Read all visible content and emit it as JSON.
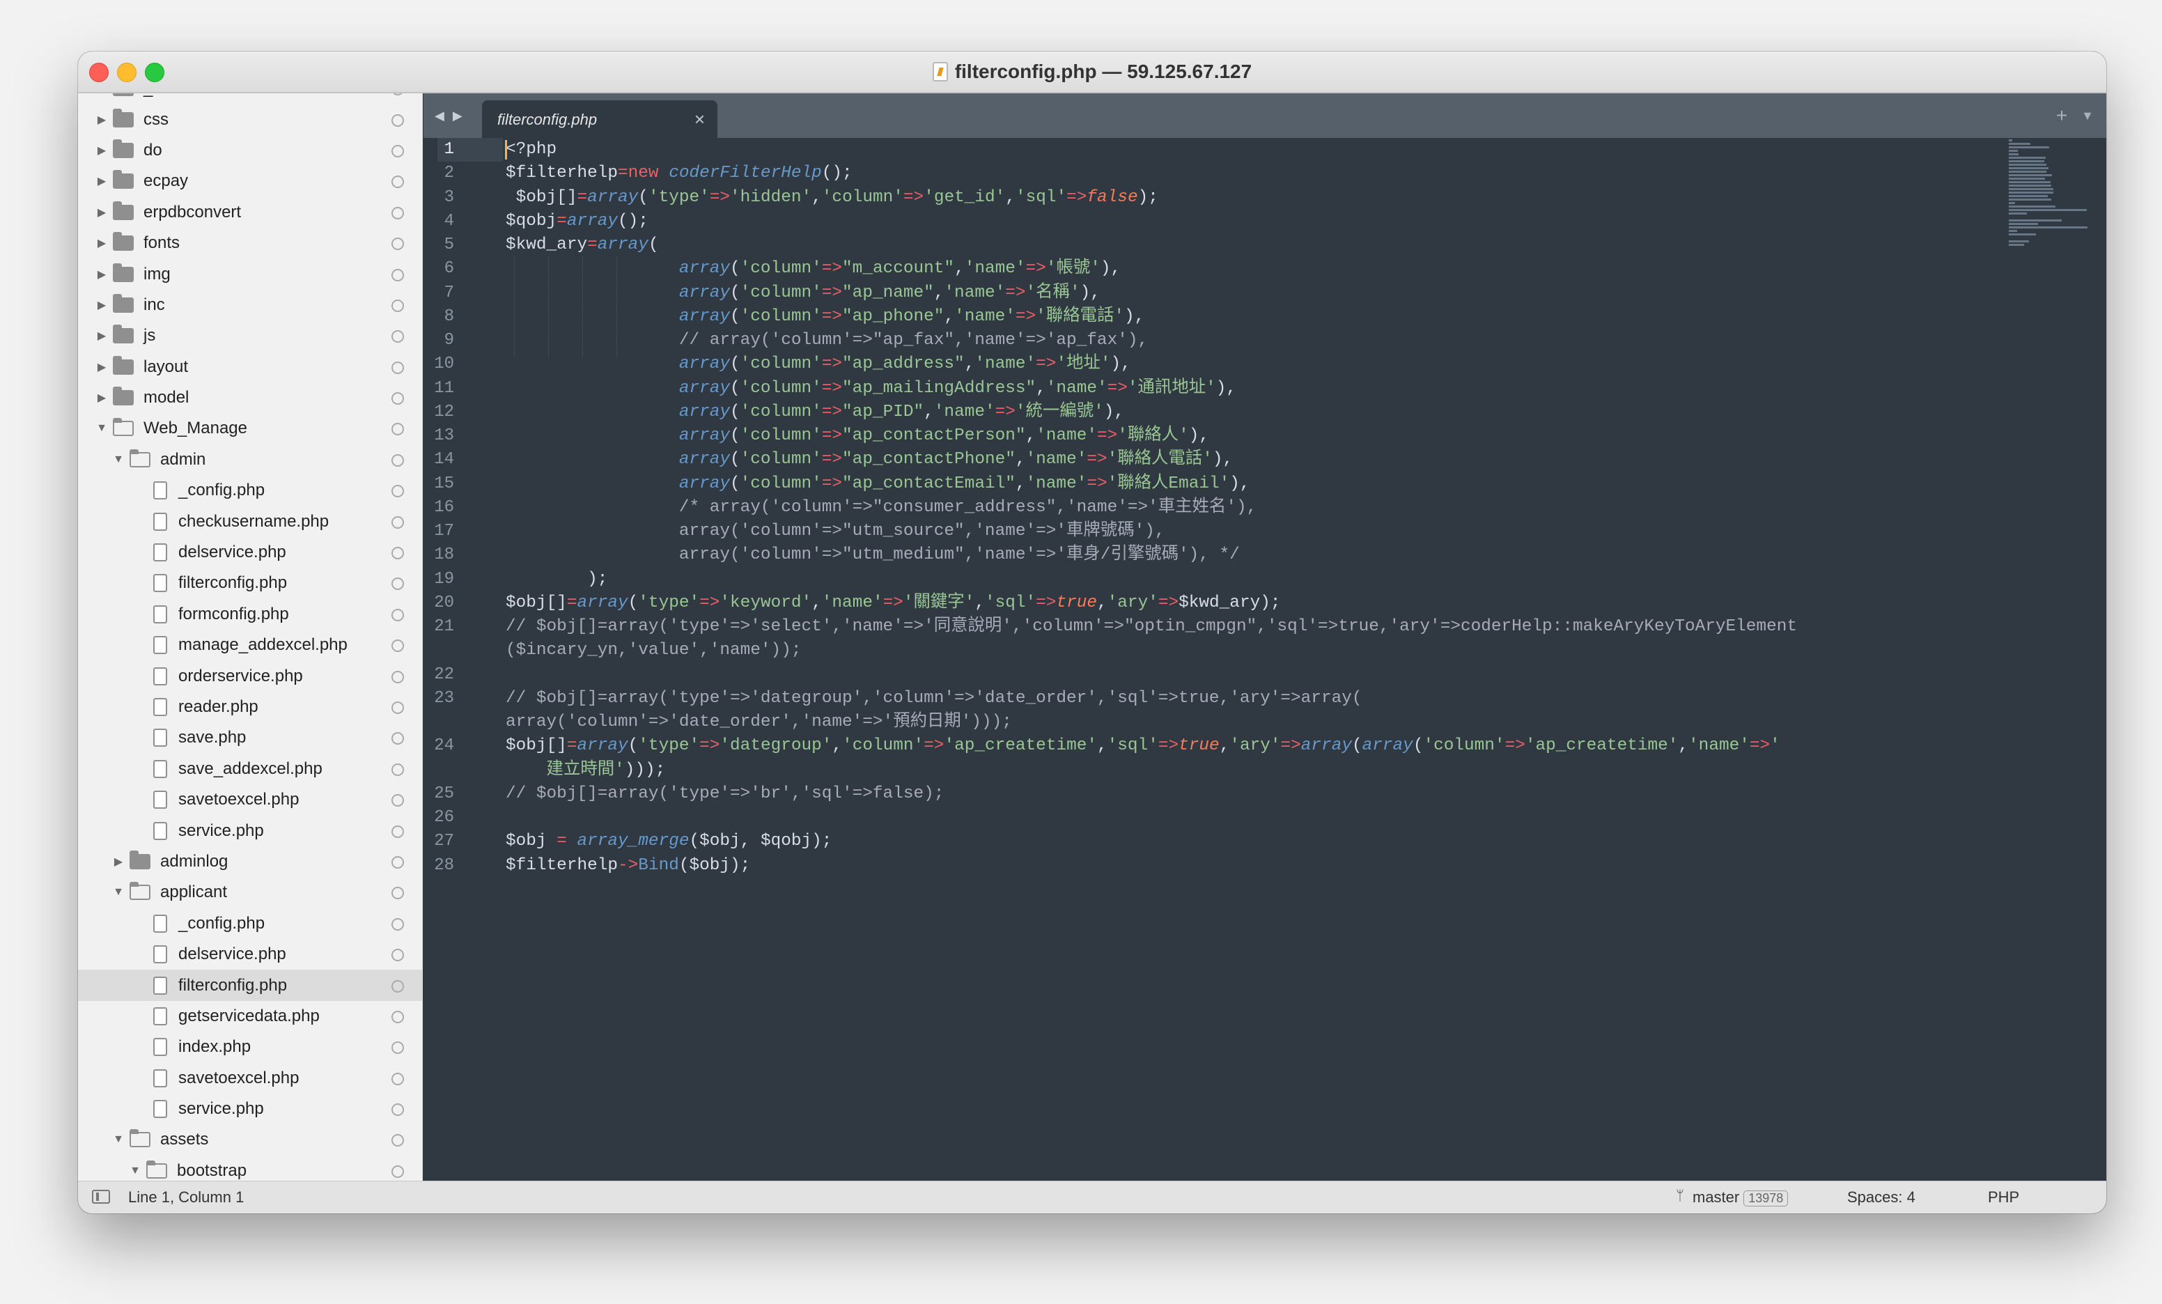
{
  "window": {
    "title": "filterconfig.php — 59.125.67.127"
  },
  "sidebar": {
    "rows": [
      {
        "depth": 0,
        "kind": "folder",
        "open": false,
        "label": "_sass"
      },
      {
        "depth": 0,
        "kind": "folder",
        "open": false,
        "label": "css"
      },
      {
        "depth": 0,
        "kind": "folder",
        "open": false,
        "label": "do"
      },
      {
        "depth": 0,
        "kind": "folder",
        "open": false,
        "label": "ecpay"
      },
      {
        "depth": 0,
        "kind": "folder",
        "open": false,
        "label": "erpdbconvert"
      },
      {
        "depth": 0,
        "kind": "folder",
        "open": false,
        "label": "fonts"
      },
      {
        "depth": 0,
        "kind": "folder",
        "open": false,
        "label": "img"
      },
      {
        "depth": 0,
        "kind": "folder",
        "open": false,
        "label": "inc"
      },
      {
        "depth": 0,
        "kind": "folder",
        "open": false,
        "label": "js"
      },
      {
        "depth": 0,
        "kind": "folder",
        "open": false,
        "label": "layout"
      },
      {
        "depth": 0,
        "kind": "folder",
        "open": false,
        "label": "model"
      },
      {
        "depth": 0,
        "kind": "folder",
        "open": true,
        "label": "Web_Manage"
      },
      {
        "depth": 1,
        "kind": "folder",
        "open": true,
        "label": "admin"
      },
      {
        "depth": 2,
        "kind": "file",
        "label": "_config.php"
      },
      {
        "depth": 2,
        "kind": "file",
        "label": "checkusername.php"
      },
      {
        "depth": 2,
        "kind": "file",
        "label": "delservice.php"
      },
      {
        "depth": 2,
        "kind": "file",
        "label": "filterconfig.php"
      },
      {
        "depth": 2,
        "kind": "file",
        "label": "formconfig.php"
      },
      {
        "depth": 2,
        "kind": "file",
        "label": "manage_addexcel.php"
      },
      {
        "depth": 2,
        "kind": "file",
        "label": "orderservice.php"
      },
      {
        "depth": 2,
        "kind": "file",
        "label": "reader.php"
      },
      {
        "depth": 2,
        "kind": "file",
        "label": "save.php"
      },
      {
        "depth": 2,
        "kind": "file",
        "label": "save_addexcel.php"
      },
      {
        "depth": 2,
        "kind": "file",
        "label": "savetoexcel.php"
      },
      {
        "depth": 2,
        "kind": "file",
        "label": "service.php"
      },
      {
        "depth": 1,
        "kind": "folder",
        "open": false,
        "label": "adminlog"
      },
      {
        "depth": 1,
        "kind": "folder",
        "open": true,
        "label": "applicant"
      },
      {
        "depth": 2,
        "kind": "file",
        "label": "_config.php"
      },
      {
        "depth": 2,
        "kind": "file",
        "label": "delservice.php"
      },
      {
        "depth": 2,
        "kind": "file",
        "label": "filterconfig.php",
        "selected": true
      },
      {
        "depth": 2,
        "kind": "file",
        "label": "getservicedata.php"
      },
      {
        "depth": 2,
        "kind": "file",
        "label": "index.php"
      },
      {
        "depth": 2,
        "kind": "file",
        "label": "savetoexcel.php"
      },
      {
        "depth": 2,
        "kind": "file",
        "label": "service.php"
      },
      {
        "depth": 1,
        "kind": "folder",
        "open": true,
        "label": "assets"
      },
      {
        "depth": 2,
        "kind": "folder",
        "open": true,
        "label": "bootstrap"
      }
    ]
  },
  "tabs": [
    {
      "label": "filterconfig.php",
      "active": true
    }
  ],
  "editor": {
    "current_line": 1,
    "line_numbers": [
      "1",
      "2",
      "3",
      "4",
      "5",
      "6",
      "7",
      "8",
      "9",
      "10",
      "11",
      "12",
      "13",
      "14",
      "15",
      "16",
      "17",
      "18",
      "19",
      "20",
      "21",
      "",
      "22",
      "23",
      "",
      "24",
      "",
      "25",
      "26",
      "27",
      "28"
    ],
    "lines": [
      [
        [
          "t",
          "<?php"
        ]
      ],
      [
        [
          "t",
          "$filterhelp"
        ],
        [
          "k",
          "=new "
        ],
        [
          "f",
          "coderFilterHelp"
        ],
        [
          "t",
          "();"
        ]
      ],
      [
        [
          "t",
          " $obj[]"
        ],
        [
          "k",
          "="
        ],
        [
          "f",
          "array"
        ],
        [
          "t",
          "("
        ],
        [
          "s",
          "'type'"
        ],
        [
          "k",
          "=>"
        ],
        [
          "s",
          "'hidden'"
        ],
        [
          "t",
          ","
        ],
        [
          "s",
          "'column'"
        ],
        [
          "k",
          "=>"
        ],
        [
          "s",
          "'get_id'"
        ],
        [
          "t",
          ","
        ],
        [
          "s",
          "'sql'"
        ],
        [
          "k",
          "=>"
        ],
        [
          "b",
          "false"
        ],
        [
          "t",
          ");"
        ]
      ],
      [
        [
          "t",
          "$qobj"
        ],
        [
          "k",
          "="
        ],
        [
          "f",
          "array"
        ],
        [
          "t",
          "();"
        ]
      ],
      [
        [
          "t",
          "$kwd_ary"
        ],
        [
          "k",
          "="
        ],
        [
          "f",
          "array"
        ],
        [
          "t",
          "("
        ]
      ],
      [
        [
          "t",
          "                 "
        ],
        [
          "f",
          "array"
        ],
        [
          "t",
          "("
        ],
        [
          "s",
          "'column'"
        ],
        [
          "k",
          "=>"
        ],
        [
          "s",
          "\"m_account\""
        ],
        [
          "t",
          ","
        ],
        [
          "s",
          "'name'"
        ],
        [
          "k",
          "=>"
        ],
        [
          "s",
          "'帳號'"
        ],
        [
          "t",
          "),"
        ]
      ],
      [
        [
          "t",
          "                 "
        ],
        [
          "f",
          "array"
        ],
        [
          "t",
          "("
        ],
        [
          "s",
          "'column'"
        ],
        [
          "k",
          "=>"
        ],
        [
          "s",
          "\"ap_name\""
        ],
        [
          "t",
          ","
        ],
        [
          "s",
          "'name'"
        ],
        [
          "k",
          "=>"
        ],
        [
          "s",
          "'名稱'"
        ],
        [
          "t",
          "),"
        ]
      ],
      [
        [
          "t",
          "                 "
        ],
        [
          "f",
          "array"
        ],
        [
          "t",
          "("
        ],
        [
          "s",
          "'column'"
        ],
        [
          "k",
          "=>"
        ],
        [
          "s",
          "\"ap_phone\""
        ],
        [
          "t",
          ","
        ],
        [
          "s",
          "'name'"
        ],
        [
          "k",
          "=>"
        ],
        [
          "s",
          "'聯絡電話'"
        ],
        [
          "t",
          "),"
        ]
      ],
      [
        [
          "c",
          "                 // array('column'=>\"ap_fax\",'name'=>'ap_fax'),"
        ]
      ],
      [
        [
          "t",
          "                 "
        ],
        [
          "f",
          "array"
        ],
        [
          "t",
          "("
        ],
        [
          "s",
          "'column'"
        ],
        [
          "k",
          "=>"
        ],
        [
          "s",
          "\"ap_address\""
        ],
        [
          "t",
          ","
        ],
        [
          "s",
          "'name'"
        ],
        [
          "k",
          "=>"
        ],
        [
          "s",
          "'地址'"
        ],
        [
          "t",
          "),"
        ]
      ],
      [
        [
          "t",
          "                 "
        ],
        [
          "f",
          "array"
        ],
        [
          "t",
          "("
        ],
        [
          "s",
          "'column'"
        ],
        [
          "k",
          "=>"
        ],
        [
          "s",
          "\"ap_mailingAddress\""
        ],
        [
          "t",
          ","
        ],
        [
          "s",
          "'name'"
        ],
        [
          "k",
          "=>"
        ],
        [
          "s",
          "'通訊地址'"
        ],
        [
          "t",
          "),"
        ]
      ],
      [
        [
          "t",
          "                 "
        ],
        [
          "f",
          "array"
        ],
        [
          "t",
          "("
        ],
        [
          "s",
          "'column'"
        ],
        [
          "k",
          "=>"
        ],
        [
          "s",
          "\"ap_PID\""
        ],
        [
          "t",
          ","
        ],
        [
          "s",
          "'name'"
        ],
        [
          "k",
          "=>"
        ],
        [
          "s",
          "'統一編號'"
        ],
        [
          "t",
          "),"
        ]
      ],
      [
        [
          "t",
          "                 "
        ],
        [
          "f",
          "array"
        ],
        [
          "t",
          "("
        ],
        [
          "s",
          "'column'"
        ],
        [
          "k",
          "=>"
        ],
        [
          "s",
          "\"ap_contactPerson\""
        ],
        [
          "t",
          ","
        ],
        [
          "s",
          "'name'"
        ],
        [
          "k",
          "=>"
        ],
        [
          "s",
          "'聯絡人'"
        ],
        [
          "t",
          "),"
        ]
      ],
      [
        [
          "t",
          "                 "
        ],
        [
          "f",
          "array"
        ],
        [
          "t",
          "("
        ],
        [
          "s",
          "'column'"
        ],
        [
          "k",
          "=>"
        ],
        [
          "s",
          "\"ap_contactPhone\""
        ],
        [
          "t",
          ","
        ],
        [
          "s",
          "'name'"
        ],
        [
          "k",
          "=>"
        ],
        [
          "s",
          "'聯絡人電話'"
        ],
        [
          "t",
          "),"
        ]
      ],
      [
        [
          "t",
          "                 "
        ],
        [
          "f",
          "array"
        ],
        [
          "t",
          "("
        ],
        [
          "s",
          "'column'"
        ],
        [
          "k",
          "=>"
        ],
        [
          "s",
          "\"ap_contactEmail\""
        ],
        [
          "t",
          ","
        ],
        [
          "s",
          "'name'"
        ],
        [
          "k",
          "=>"
        ],
        [
          "s",
          "'聯絡人Email'"
        ],
        [
          "t",
          "),"
        ]
      ],
      [
        [
          "c",
          "                 /* array('column'=>\"consumer_address\",'name'=>'車主姓名'),"
        ]
      ],
      [
        [
          "c",
          "                 array('column'=>\"utm_source\",'name'=>'車牌號碼'),"
        ]
      ],
      [
        [
          "c",
          "                 array('column'=>\"utm_medium\",'name'=>'車身/引擎號碼'), */"
        ]
      ],
      [
        [
          "t",
          "        );"
        ]
      ],
      [
        [
          "t",
          "$obj[]"
        ],
        [
          "k",
          "="
        ],
        [
          "f",
          "array"
        ],
        [
          "t",
          "("
        ],
        [
          "s",
          "'type'"
        ],
        [
          "k",
          "=>"
        ],
        [
          "s",
          "'keyword'"
        ],
        [
          "t",
          ","
        ],
        [
          "s",
          "'name'"
        ],
        [
          "k",
          "=>"
        ],
        [
          "s",
          "'關鍵字'"
        ],
        [
          "t",
          ","
        ],
        [
          "s",
          "'sql'"
        ],
        [
          "k",
          "=>"
        ],
        [
          "b",
          "true"
        ],
        [
          "t",
          ","
        ],
        [
          "s",
          "'ary'"
        ],
        [
          "k",
          "=>"
        ],
        [
          "t",
          "$kwd_ary);"
        ]
      ],
      [
        [
          "c",
          "// $obj[]=array('type'=>'select','name'=>'同意說明','column'=>\"optin_cmpgn\",'sql'=>true,'ary'=>coderHelp::makeAryKeyToAryElement"
        ]
      ],
      [
        [
          "c",
          "($incary_yn,'value','name'));"
        ]
      ],
      [
        [
          "t",
          ""
        ]
      ],
      [
        [
          "c",
          "// $obj[]=array('type'=>'dategroup','column'=>'date_order','sql'=>true,'ary'=>array("
        ]
      ],
      [
        [
          "c",
          "array('column'=>'date_order','name'=>'預約日期')));"
        ]
      ],
      [
        [
          "t",
          "$obj[]"
        ],
        [
          "k",
          "="
        ],
        [
          "f",
          "array"
        ],
        [
          "t",
          "("
        ],
        [
          "s",
          "'type'"
        ],
        [
          "k",
          "=>"
        ],
        [
          "s",
          "'dategroup'"
        ],
        [
          "t",
          ","
        ],
        [
          "s",
          "'column'"
        ],
        [
          "k",
          "=>"
        ],
        [
          "s",
          "'ap_createtime'"
        ],
        [
          "t",
          ","
        ],
        [
          "s",
          "'sql'"
        ],
        [
          "k",
          "=>"
        ],
        [
          "b",
          "true"
        ],
        [
          "t",
          ","
        ],
        [
          "s",
          "'ary'"
        ],
        [
          "k",
          "=>"
        ],
        [
          "f",
          "array"
        ],
        [
          "t",
          "("
        ],
        [
          "f",
          "array"
        ],
        [
          "t",
          "("
        ],
        [
          "s",
          "'column'"
        ],
        [
          "k",
          "=>"
        ],
        [
          "s",
          "'ap_createtime'"
        ],
        [
          "t",
          ","
        ],
        [
          "s",
          "'name'"
        ],
        [
          "k",
          "=>"
        ],
        [
          "s",
          "'"
        ]
      ],
      [
        [
          "s",
          "    建立時間'"
        ],
        [
          "t",
          ")));"
        ]
      ],
      [
        [
          "c",
          "// $obj[]=array('type'=>'br','sql'=>false);"
        ]
      ],
      [
        [
          "t",
          ""
        ]
      ],
      [
        [
          "t",
          "$obj "
        ],
        [
          "k",
          "= "
        ],
        [
          "f",
          "array_merge"
        ],
        [
          "t",
          "($obj, $qobj);"
        ]
      ],
      [
        [
          "t",
          "$filterhelp"
        ],
        [
          "k",
          "->"
        ],
        [
          "fv",
          "Bind"
        ],
        [
          "t",
          "($obj);"
        ]
      ]
    ]
  },
  "statusbar": {
    "position": "Line 1, Column 1",
    "branch": "master",
    "branch_count": "13978",
    "indent": "Spaces: 4",
    "syntax": "PHP"
  }
}
